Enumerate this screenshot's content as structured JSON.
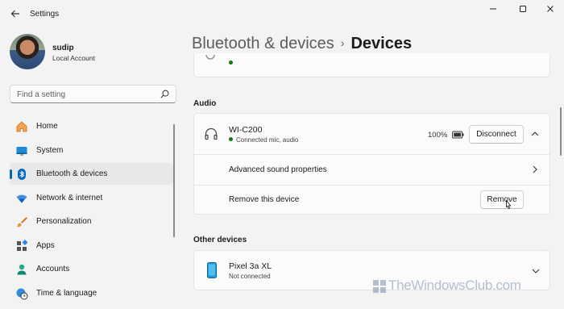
{
  "window": {
    "title": "Settings",
    "back_icon": "arrow-left-icon",
    "controls": [
      "minimize-icon",
      "maximize-icon",
      "close-icon"
    ]
  },
  "profile": {
    "name": "sudip",
    "account_type": "Local Account"
  },
  "search": {
    "placeholder": "Find a setting",
    "icon": "search-icon"
  },
  "sidebar": {
    "items": [
      {
        "label": "Home",
        "icon": "home-icon",
        "active": false
      },
      {
        "label": "System",
        "icon": "monitor-icon",
        "active": false
      },
      {
        "label": "Bluetooth & devices",
        "icon": "bluetooth-icon",
        "active": true
      },
      {
        "label": "Network & internet",
        "icon": "wifi-icon",
        "active": false
      },
      {
        "label": "Personalization",
        "icon": "brush-icon",
        "active": false
      },
      {
        "label": "Apps",
        "icon": "apps-icon",
        "active": false
      },
      {
        "label": "Accounts",
        "icon": "person-icon",
        "active": false
      },
      {
        "label": "Time & language",
        "icon": "globe-clock-icon",
        "active": false
      }
    ]
  },
  "breadcrumb": {
    "parent": "Bluetooth & devices",
    "separator": "›",
    "current": "Devices"
  },
  "audio": {
    "section_title": "Audio",
    "device": {
      "name": "WI-C200",
      "status": "Connected mic, audio",
      "battery": "100%",
      "disconnect_label": "Disconnect"
    },
    "advanced_label": "Advanced sound properties",
    "remove_row_label": "Remove this device",
    "remove_button": "Remove"
  },
  "other_devices": {
    "section_title": "Other devices",
    "device": {
      "name": "Pixel 3a XL",
      "status": "Not connected"
    }
  },
  "watermark": "TheWindowsClub.com",
  "colors": {
    "accent": "#0067c0",
    "connected": "#0f7b0f"
  }
}
